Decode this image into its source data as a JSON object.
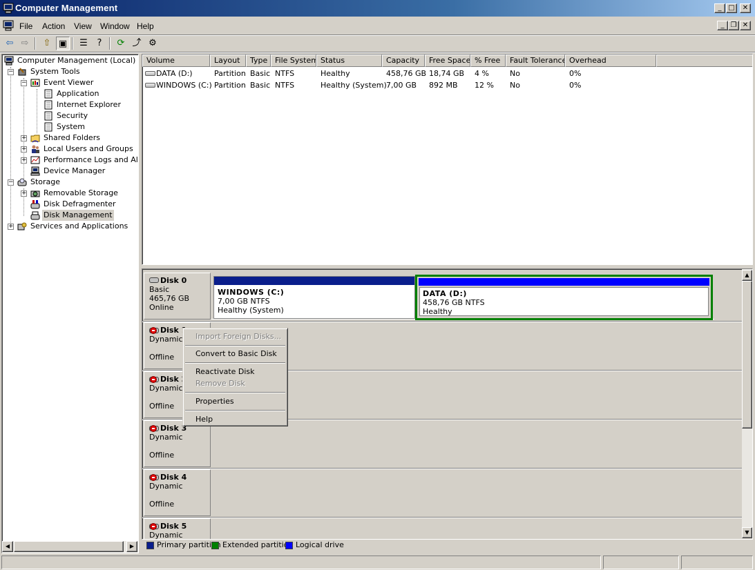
{
  "window": {
    "title": "Computer Management",
    "controls": {
      "minimize": "_",
      "maximize": "□",
      "close": "✕"
    },
    "inner_controls": {
      "minimize": "_",
      "restore": "❐",
      "close": "✕"
    }
  },
  "menu": {
    "file": "File",
    "action": "Action",
    "view": "View",
    "window": "Window",
    "help": "Help"
  },
  "toolbar": {
    "back": "⇦",
    "forward": "⇨",
    "up": "⇧",
    "show_hide": "▣",
    "properties": "☰",
    "help": "?",
    "refresh": "⟳",
    "export": "⤴",
    "settings": "⚙"
  },
  "tree": {
    "root": "Computer Management (Local)",
    "system_tools": "System Tools",
    "event_viewer": "Event Viewer",
    "application": "Application",
    "internet_explorer": "Internet Explorer",
    "security": "Security",
    "system": "System",
    "shared_folders": "Shared Folders",
    "local_users": "Local Users and Groups",
    "perf_logs": "Performance Logs and Alerts",
    "device_manager": "Device Manager",
    "storage": "Storage",
    "removable_storage": "Removable Storage",
    "disk_defrag": "Disk Defragmenter",
    "disk_management": "Disk Management",
    "services_apps": "Services and Applications"
  },
  "volume_list": {
    "columns": [
      "Volume",
      "Layout",
      "Type",
      "File System",
      "Status",
      "Capacity",
      "Free Space",
      "% Free",
      "Fault Tolerance",
      "Overhead"
    ],
    "rows": [
      [
        "DATA (D:)",
        "Partition",
        "Basic",
        "NTFS",
        "Healthy",
        "458,76 GB",
        "18,74 GB",
        "4 %",
        "No",
        "0%"
      ],
      [
        "WINDOWS (C:)",
        "Partition",
        "Basic",
        "NTFS",
        "Healthy (System)",
        "7,00 GB",
        "892 MB",
        "12 %",
        "No",
        "0%"
      ]
    ]
  },
  "disks": {
    "disk0": {
      "name": "Disk 0",
      "type": "Basic",
      "size": "465,76 GB",
      "status": "Online",
      "partitions": [
        {
          "name": "WINDOWS  (C:)",
          "size": "7,00 GB NTFS",
          "status": "Healthy (System)",
          "color": "#0a1e8c"
        },
        {
          "name": "DATA  (D:)",
          "size": "458,76 GB NTFS",
          "status": "Healthy",
          "color": "#0000ff"
        }
      ]
    },
    "disk1": {
      "name": "Disk 1",
      "type": "Dynamic",
      "status": "Offline"
    },
    "disk2": {
      "name": "Disk 2",
      "type": "Dynamic",
      "status": "Offline"
    },
    "disk3": {
      "name": "Disk 3",
      "type": "Dynamic",
      "status": "Offline"
    },
    "disk4": {
      "name": "Disk 4",
      "type": "Dynamic",
      "status": "Offline"
    },
    "disk5": {
      "name": "Disk 5",
      "type": "Dynamic"
    }
  },
  "legend": {
    "primary": "Primary partition",
    "primary_color": "#0a1e8c",
    "extended": "Extended partition",
    "extended_color": "#008000",
    "logical": "Logical drive",
    "logical_color": "#0000ff"
  },
  "context_menu": {
    "import_foreign": "Import Foreign Disks...",
    "convert_basic": "Convert to Basic Disk",
    "reactivate": "Reactivate Disk",
    "remove": "Remove Disk",
    "properties": "Properties",
    "help": "Help"
  }
}
